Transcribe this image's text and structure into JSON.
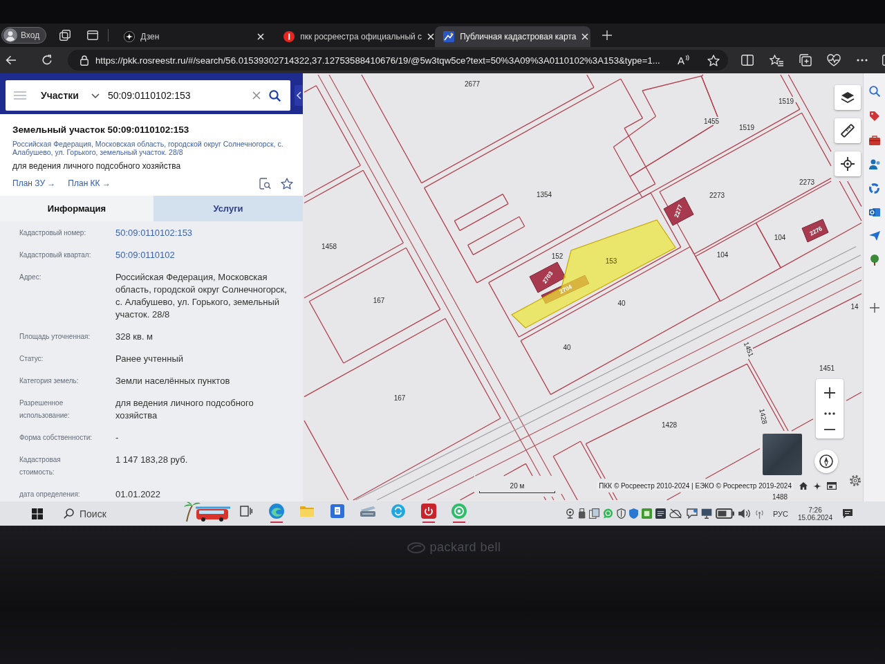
{
  "device": {
    "logo": "packard bell"
  },
  "browser": {
    "profile": "Вход",
    "tabs": [
      {
        "title": "Дзен",
        "kind": "star",
        "selected": false
      },
      {
        "title": "пкк росреестра официальный с",
        "kind": "circle",
        "selected": false
      },
      {
        "title": "Публичная кадастровая карта",
        "kind": "square",
        "selected": true
      }
    ],
    "url": "https://pkk.rosreestr.ru/#/search/56.01539302714322,37.12753588410676/19/@5w3tqw5ce?text=50%3A09%3A0110102%3A153&type=1...",
    "read_aloud": "A"
  },
  "search": {
    "category": "Участки",
    "query": "50:09:0110102:153"
  },
  "card": {
    "title": "Земельный участок 50:09:0110102:153",
    "address": "Российская Федерация, Московская область, городской округ Солнечногорск, с. Алабушево, ул. Горького, земельный участок. 28/8",
    "purpose": "для ведения личного подсобного хозяйства",
    "links": [
      "План ЗУ →",
      "План КК →"
    ]
  },
  "info_tabs": [
    {
      "label": "Информация",
      "selected": true
    },
    {
      "label": "Услуги",
      "selected": false
    }
  ],
  "fields": [
    {
      "label": "Кадастровый номер:",
      "value": "50:09:0110102:153",
      "kind": "link"
    },
    {
      "label": "Кадастровый квартал:",
      "value": "50:09:0110102",
      "kind": "link"
    },
    {
      "label": "Адрес:",
      "value": "Российская Федерация, Московская область, городской округ Солнечногорск, с. Алабушево, ул. Горького, земельный участок. 28/8",
      "kind": "text"
    },
    {
      "label": "Площадь уточненная:",
      "value": "328 кв. м",
      "kind": "text"
    },
    {
      "label": "Статус:",
      "value": "Ранее учтенный",
      "kind": "text"
    },
    {
      "label": "Категория земель:",
      "value": "Земли населённых пунктов",
      "kind": "text"
    },
    {
      "label": "Разрешенное использование:",
      "value": "для ведения личного подсобного хозяйства",
      "kind": "text"
    },
    {
      "label": "Форма собственности:",
      "value": "-",
      "kind": "text"
    },
    {
      "label": "Кадастровая стоимость:",
      "value": "1 147 183,28 руб.",
      "kind": "text"
    },
    {
      "label": "дата определения:",
      "value": "01.01.2022",
      "kind": "text"
    }
  ],
  "map": {
    "parcel_labels": [
      "2677",
      "1455",
      "1519",
      "1519",
      "2273",
      "2273",
      "1354",
      "1458",
      "104",
      "104",
      "167",
      "40",
      "40",
      "167",
      "1451",
      "1451",
      "1428",
      "1428",
      "14",
      "1488",
      "152"
    ],
    "selected_parcel": "153",
    "buildings": [
      "2703",
      "2704",
      "2277",
      "2276"
    ],
    "scale": "20 м",
    "attribution": "ПКК © Росреестр 2010-2024 | ЕЭКО © Росреестр 2019-2024"
  },
  "taskbar": {
    "search": {
      "placeholder": "Поиск"
    },
    "apps": [
      {
        "kind": "widget",
        "running": false
      },
      {
        "kind": "taskview",
        "running": false
      },
      {
        "kind": "browser",
        "running": true
      },
      {
        "kind": "folder",
        "running": false
      },
      {
        "kind": "tile",
        "running": false
      },
      {
        "kind": "scanner",
        "running": false
      },
      {
        "kind": "chat",
        "running": false
      },
      {
        "kind": "power",
        "running": true
      },
      {
        "kind": "ring",
        "running": true
      }
    ],
    "language": "РУС",
    "time": "7:26",
    "date": "15.06.2024"
  }
}
